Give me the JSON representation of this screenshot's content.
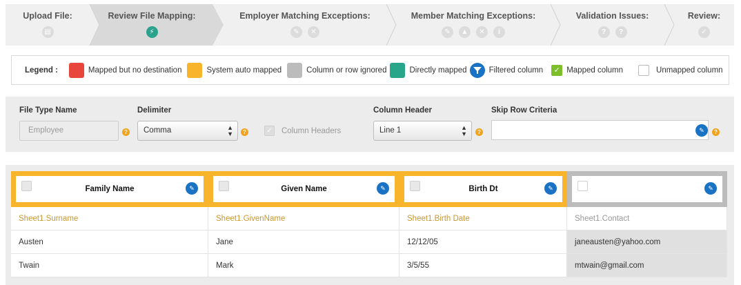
{
  "wizard": {
    "steps": [
      {
        "label": "Upload File:",
        "icons": [
          "calendar-icon"
        ]
      },
      {
        "label": "Review File Mapping:",
        "icons": [
          "plug-icon"
        ]
      },
      {
        "label": "Employer Matching Exceptions:",
        "icons": [
          "pencil-icon",
          "x-icon"
        ]
      },
      {
        "label": "Member Matching Exceptions:",
        "icons": [
          "pencil-icon",
          "warning-icon",
          "x-icon",
          "info-icon"
        ]
      },
      {
        "label": "Validation Issues:",
        "icons": [
          "question-icon",
          "question-icon"
        ]
      },
      {
        "label": "Review:",
        "icons": [
          "checklist-icon"
        ]
      }
    ],
    "active_step": 1
  },
  "legend": {
    "title": "Legend :",
    "items": [
      {
        "label": "Mapped but no destination",
        "color": "#e8453c"
      },
      {
        "label": "System auto mapped",
        "color": "#f8b52c"
      },
      {
        "label": "Column or row ignored",
        "color": "#bcbcbc"
      },
      {
        "label": "Directly mapped",
        "color": "#28a68a"
      },
      {
        "label": "Filtered column",
        "color": "#1a72c4"
      },
      {
        "label": "Mapped column",
        "color": "#7cbf2a"
      },
      {
        "label": "Unmapped column",
        "color": "#ffffff"
      }
    ]
  },
  "form": {
    "file_type": {
      "label": "File Type Name",
      "placeholder": "Employee"
    },
    "delimiter": {
      "label": "Delimiter",
      "value": "Comma"
    },
    "column_headers_checkbox": {
      "label": "Column Headers"
    },
    "column_header": {
      "label": "Column Header",
      "value": "Line 1"
    },
    "skip_row": {
      "label": "Skip Row Criteria",
      "value": ""
    }
  },
  "grid": {
    "columns": [
      {
        "title": "Family Name",
        "source": "Sheet1.Surname",
        "status": "auto-mapped",
        "cells": [
          "Austen",
          "Twain"
        ]
      },
      {
        "title": "Given Name",
        "source": "Sheet1.GivenName",
        "status": "auto-mapped",
        "cells": [
          "Jane",
          "Mark"
        ]
      },
      {
        "title": "Birth Dt",
        "source": "Sheet1.Birth Date",
        "status": "auto-mapped",
        "cells": [
          "12/12/05",
          "3/5/55"
        ]
      },
      {
        "title": "",
        "source": "Sheet1.Contact",
        "status": "ignored",
        "cells": [
          "janeausten@yahoo.com",
          "mtwain@gmail.com"
        ]
      }
    ]
  }
}
